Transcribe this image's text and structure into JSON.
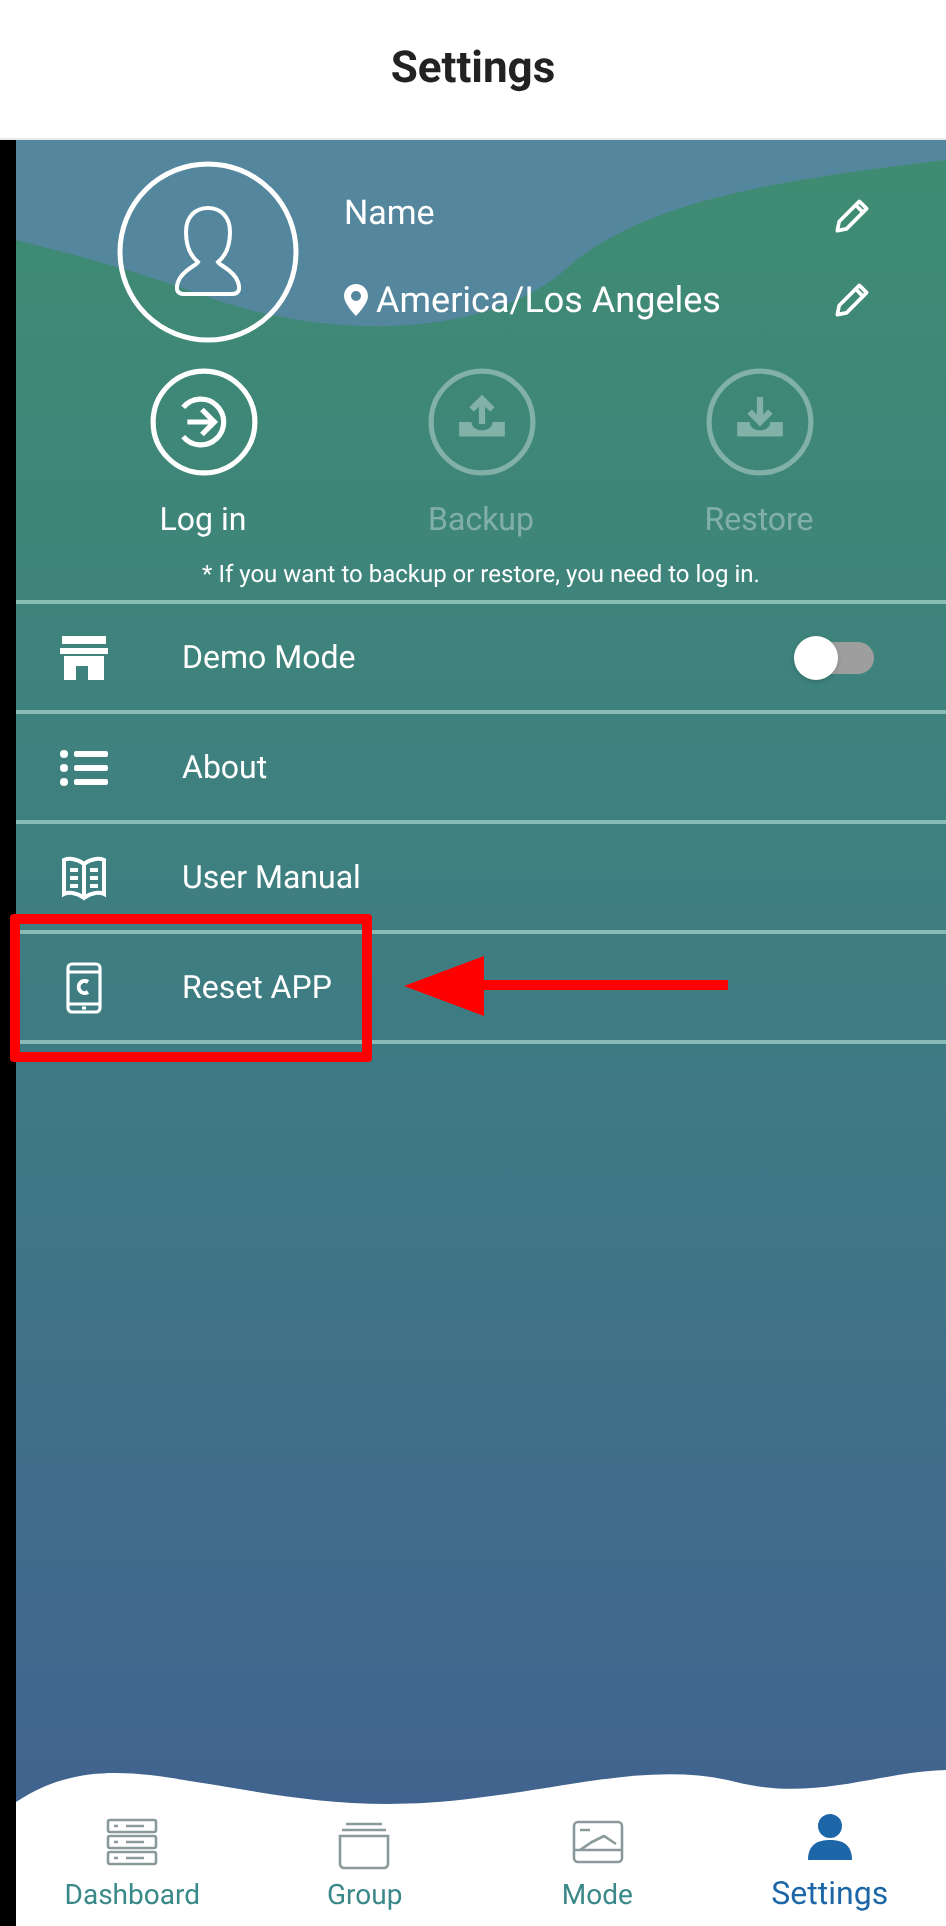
{
  "header": {
    "title": "Settings"
  },
  "profile": {
    "name": "Name",
    "location": "America/Los Angeles"
  },
  "actions": [
    {
      "kind": "login",
      "label": "Log in",
      "disabled": false
    },
    {
      "kind": "backup",
      "label": "Backup",
      "disabled": true
    },
    {
      "kind": "restore",
      "label": "Restore",
      "disabled": true
    }
  ],
  "note": "* If you want to backup or restore, you need to log in.",
  "menu": [
    {
      "kind": "store",
      "label": "Demo Mode",
      "toggle": {
        "on": false
      }
    },
    {
      "kind": "list",
      "label": "About"
    },
    {
      "kind": "book",
      "label": "User Manual"
    },
    {
      "kind": "phone",
      "label": "Reset APP"
    }
  ],
  "nav": [
    {
      "kind": "dashboard",
      "label": "Dashboard",
      "selected": false
    },
    {
      "kind": "group",
      "label": "Group",
      "selected": false
    },
    {
      "kind": "mode",
      "label": "Mode",
      "selected": false
    },
    {
      "kind": "settings",
      "label": "Settings",
      "selected": true
    }
  ]
}
